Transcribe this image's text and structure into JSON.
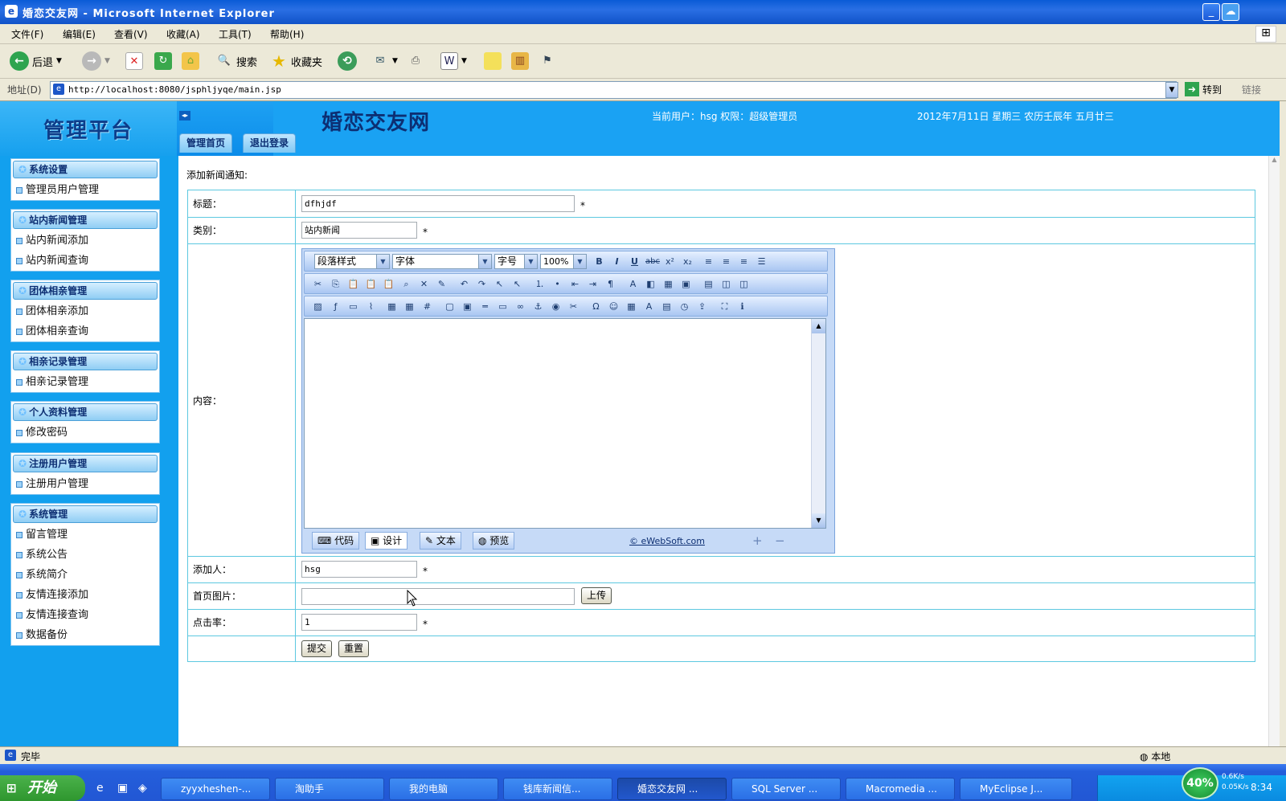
{
  "window": {
    "title": "婚恋交友网 - Microsoft Internet Explorer",
    "controls": [
      "_",
      "□",
      "✕"
    ]
  },
  "menu": [
    "文件(F)",
    "编辑(E)",
    "查看(V)",
    "收藏(A)",
    "工具(T)",
    "帮助(H)"
  ],
  "toolbar": {
    "back": "后退",
    "search": "搜索",
    "favorites": "收藏夹"
  },
  "address": {
    "label": "地址(D)",
    "url": "http://localhost:8080/jsphljyqe/main.jsp",
    "go": "转到",
    "links": "链接"
  },
  "banner": {
    "logo": "管理平台",
    "site_title": "婚恋交友网",
    "current_user": "当前用户：hsg 权限：超级管理员",
    "date": "2012年7月11日 星期三 农历壬辰年 五月廿三",
    "nav": [
      "管理首页",
      "退出登录"
    ]
  },
  "sidebar": [
    {
      "title": "系统设置",
      "items": [
        "管理员用户管理"
      ]
    },
    {
      "title": "站内新闻管理",
      "items": [
        "站内新闻添加",
        "站内新闻查询"
      ]
    },
    {
      "title": "团体相亲管理",
      "items": [
        "团体相亲添加",
        "团体相亲查询"
      ]
    },
    {
      "title": "相亲记录管理",
      "items": [
        "相亲记录管理"
      ]
    },
    {
      "title": "个人资料管理",
      "items": [
        "修改密码"
      ]
    },
    {
      "title": "注册用户管理",
      "items": [
        "注册用户管理"
      ]
    },
    {
      "title": "系统管理",
      "items": [
        "留言管理",
        "系统公告",
        "系统简介",
        "友情连接添加",
        "友情连接查询",
        "数据备份"
      ]
    }
  ],
  "form": {
    "caption": "添加新闻通知:",
    "title_label": "标题：",
    "title_value": "dfhjdf",
    "category_label": "类别：",
    "category_value": "站内新闻",
    "content_label": "内容：",
    "author_label": "添加人：",
    "author_value": "hsg",
    "image_label": "首页图片：",
    "image_value": "",
    "upload": "上传",
    "clicks_label": "点击率：",
    "clicks_value": "1",
    "required": "*",
    "submit": "提交",
    "reset": "重置"
  },
  "editor": {
    "paragraph_style": "段落样式",
    "font": "字体",
    "font_size": "字号",
    "zoom": "100%",
    "tabs": [
      "代码",
      "设计",
      "文本",
      "预览"
    ],
    "active_tab": "设计",
    "copyright": "© eWebSoft.com"
  },
  "status": {
    "text": "完毕",
    "zone": "本地"
  },
  "taskbar": {
    "start": "开始",
    "tasks": [
      "zyyxheshen-...",
      "淘助手",
      "我的电脑",
      "钱库新闻信...",
      "婚恋交友网 ...",
      "SQL Server ...",
      "Macromedia ...",
      "MyEclipse J..."
    ],
    "active_task": "婚恋交友网 ...",
    "net_percent": "40%",
    "up_speed": "0.6K/s",
    "down_speed": "0.05K/s",
    "clock": "8:34"
  }
}
